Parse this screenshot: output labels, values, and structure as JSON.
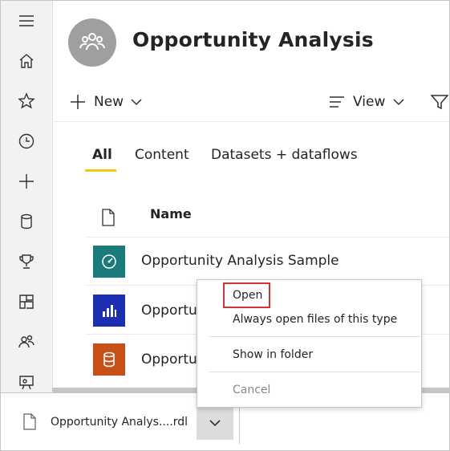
{
  "workspace": {
    "title": "Opportunity Analysis",
    "avatar_icon": "people-group-icon"
  },
  "toolbar": {
    "new_label": "New",
    "view_label": "View"
  },
  "tabs": [
    {
      "label": "All",
      "active": true
    },
    {
      "label": "Content",
      "active": false
    },
    {
      "label": "Datasets + dataflows",
      "active": false
    }
  ],
  "table": {
    "header": {
      "name": "Name"
    },
    "rows": [
      {
        "name": "Opportunity Analysis Sample",
        "icon": "dashboard-gauge-icon",
        "color": "#1b7b7b"
      },
      {
        "name": "Opportunity Analysis Sample",
        "icon": "report-bar-chart-icon",
        "color": "#1c2fb0"
      },
      {
        "name": "Opportunity Analysis Sample",
        "icon": "dataset-database-icon",
        "color": "#c8501a"
      }
    ]
  },
  "context_menu": {
    "open": "Open",
    "always_open": "Always open files of this type",
    "show_in_folder": "Show in folder",
    "cancel": "Cancel"
  },
  "download": {
    "file_name": "Opportunity Analys....rdl"
  },
  "colors": {
    "highlight": "#d13438",
    "tab_underline": "#f2c811",
    "rail_bg": "#f3f2f1"
  }
}
